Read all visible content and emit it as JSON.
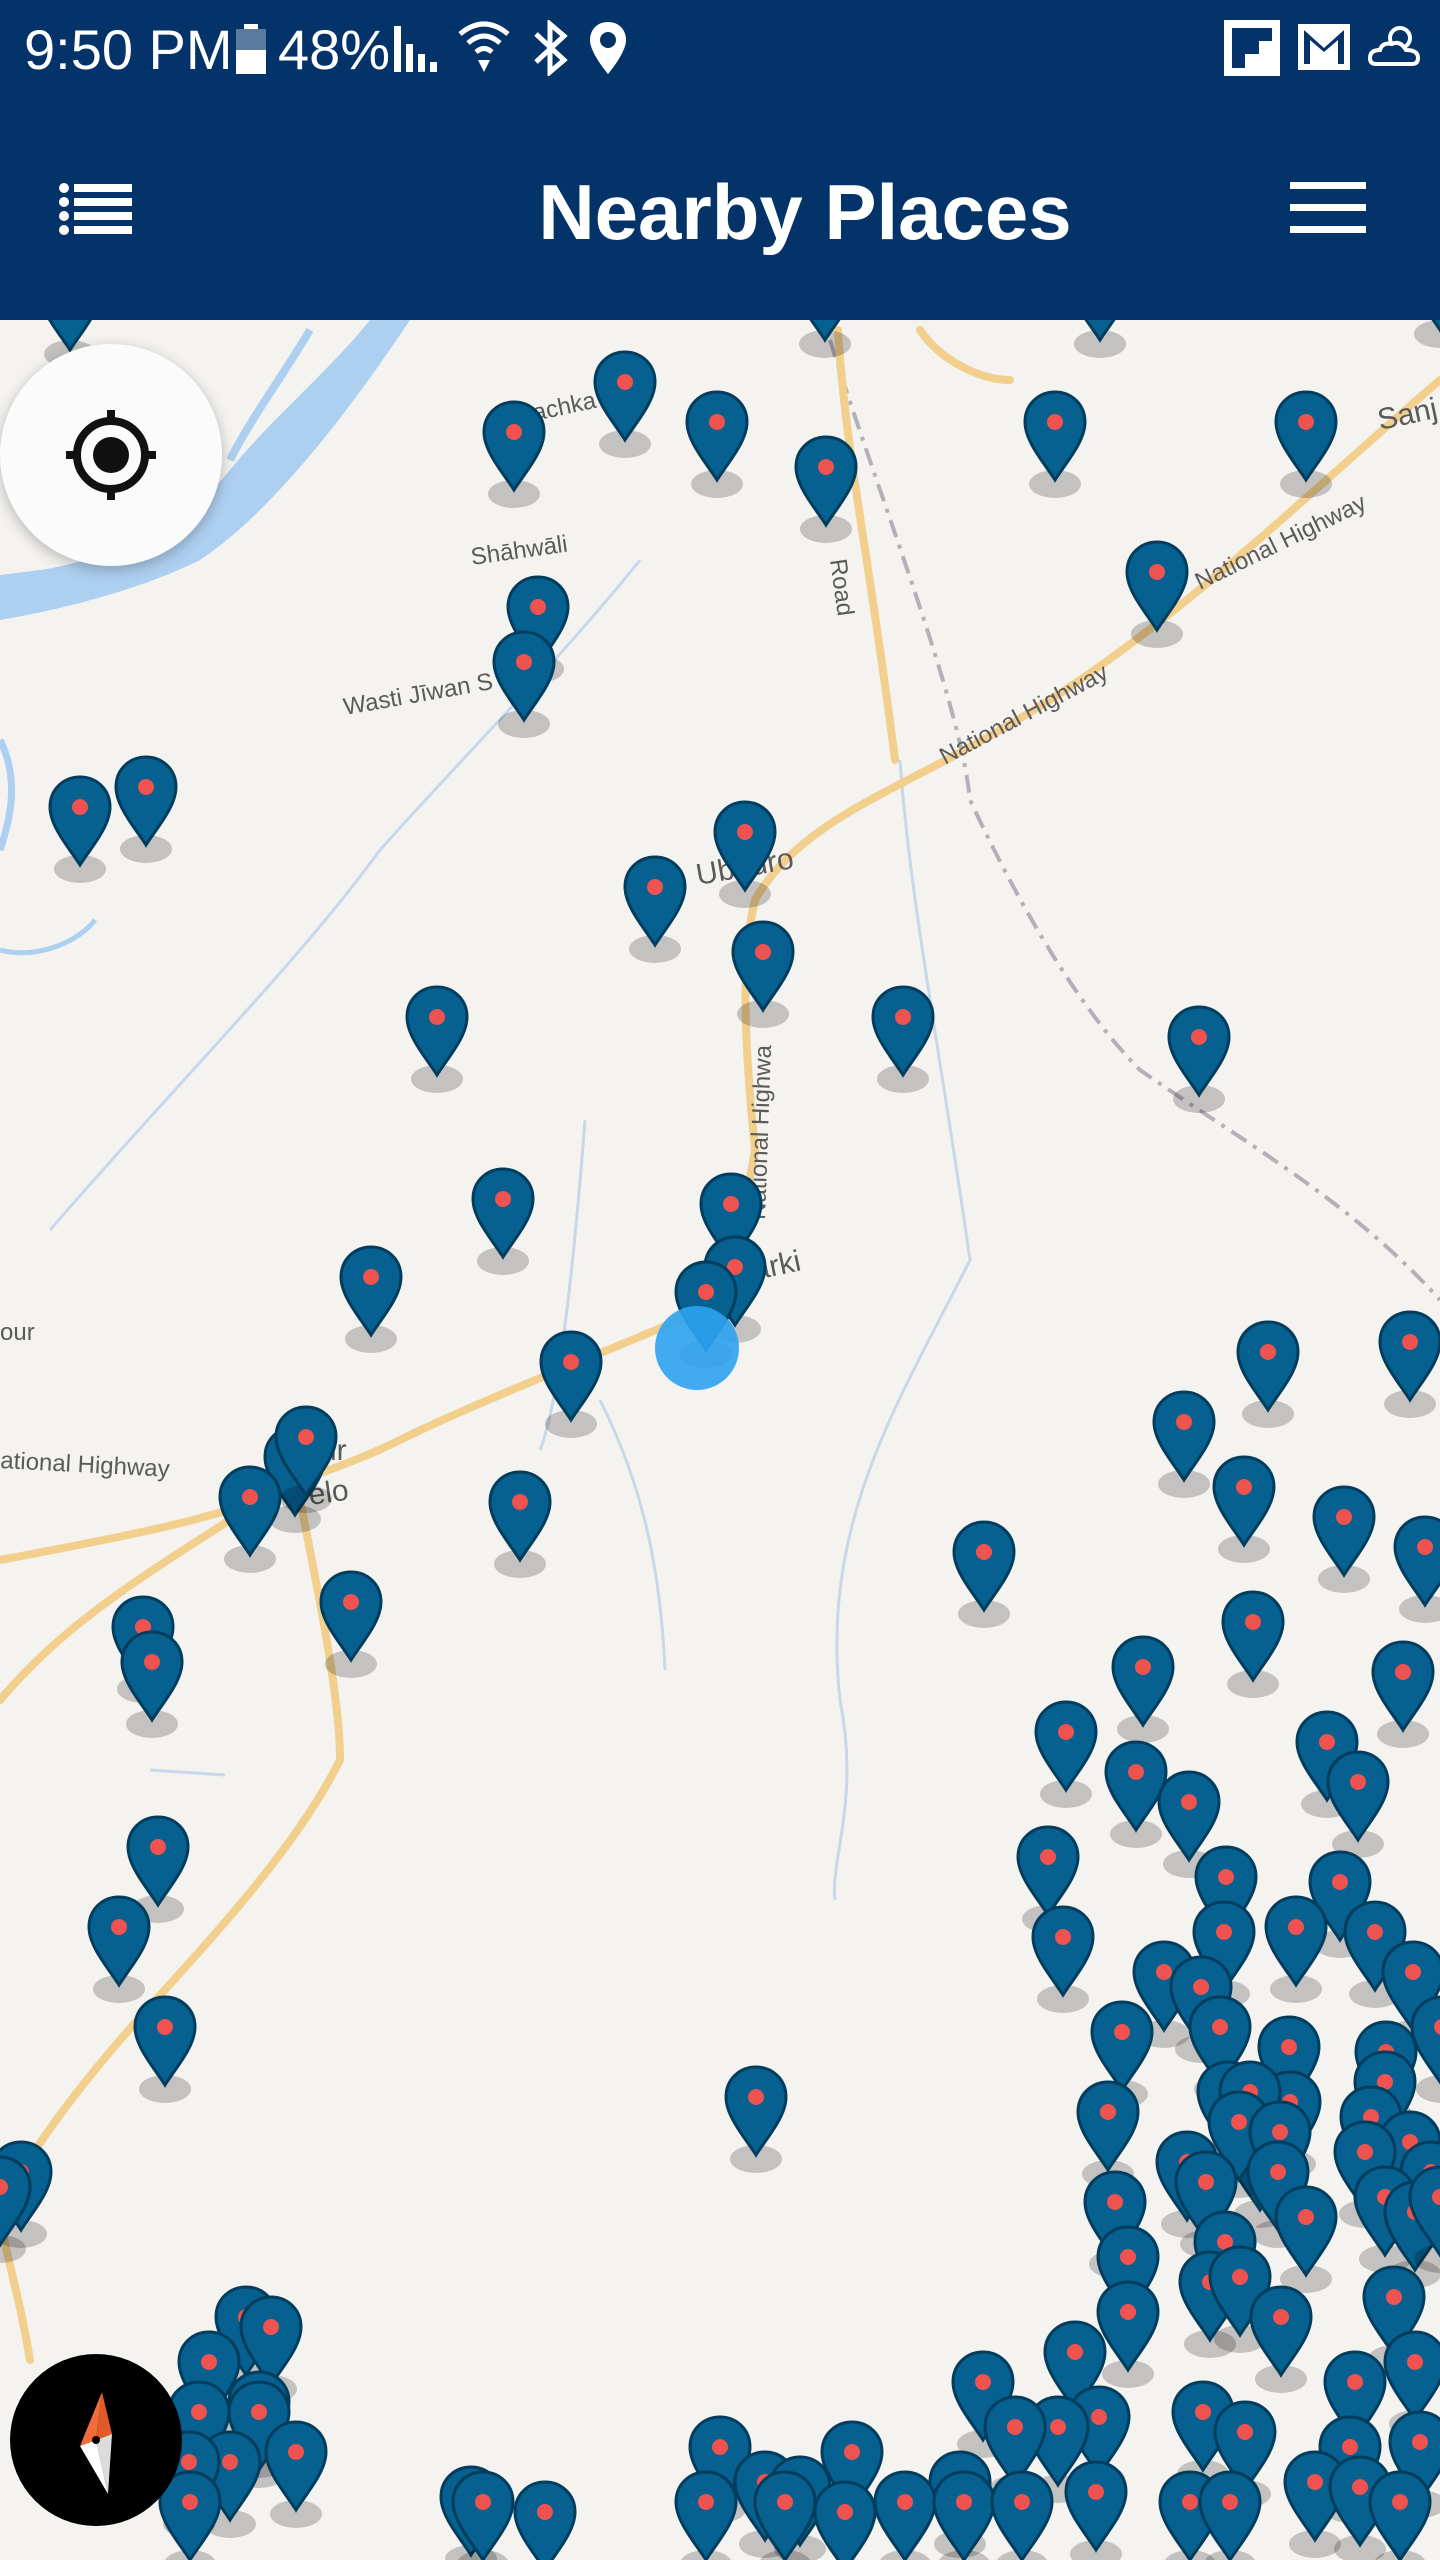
{
  "status_bar": {
    "time": "9:50 PM",
    "battery": "48%",
    "icons": [
      "battery-icon",
      "signal-icon",
      "wifi-icon",
      "bluetooth-icon",
      "location-icon",
      "flipboard-icon",
      "gmail-icon",
      "weather-icon"
    ]
  },
  "app_bar": {
    "title": "Nearby Places",
    "left_icon": "list-icon",
    "right_icon": "menu-icon"
  },
  "map": {
    "labels": {
      "machka": "Machka",
      "shahwali": "Shāhwāli",
      "wasti_jiwan": "Wasti Jīwan S",
      "ubauro": "Ubauro",
      "arki": "arki",
      "national_highway_ne": "National Highway",
      "national_highway_ne2": "National Highway",
      "national_highway_v": "National Highwa",
      "national_highway_w": "ational Highway",
      "road": "Road",
      "sanj": "Sanj",
      "our": "our",
      "elo": "elo",
      "ur": "ur"
    },
    "colors": {
      "pin": "#066090",
      "pin_dot": "#ef5350",
      "user_location": "#2ea3f2",
      "water": "#aed0f0",
      "road": "#f2cf8c",
      "land": "#f5f3f0",
      "header": "#04336a"
    }
  },
  "controls": {
    "locate_icon": "crosshair-icon",
    "compass_icon": "compass-icon"
  }
}
